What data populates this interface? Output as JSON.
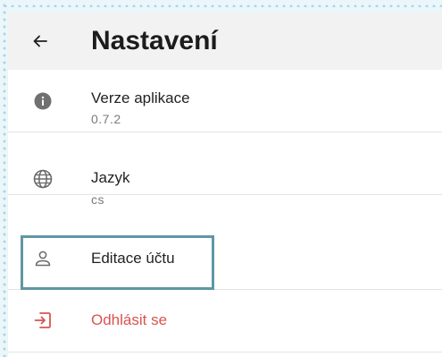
{
  "header": {
    "title": "Nastavení",
    "back_icon": "arrow-left-icon"
  },
  "settings": {
    "version": {
      "label": "Verze aplikace",
      "value": "0.7.2",
      "icon": "info-icon"
    },
    "language": {
      "label": "Jazyk",
      "value": "cs",
      "icon": "globe-icon"
    },
    "account": {
      "label": "Editace účtu",
      "icon": "user-icon"
    },
    "logout": {
      "label": "Odhlásit se",
      "icon": "logout-icon"
    }
  },
  "colors": {
    "logout": "#d9534f",
    "highlight": "#5e97a6",
    "header_bg": "#f2f2f2"
  }
}
